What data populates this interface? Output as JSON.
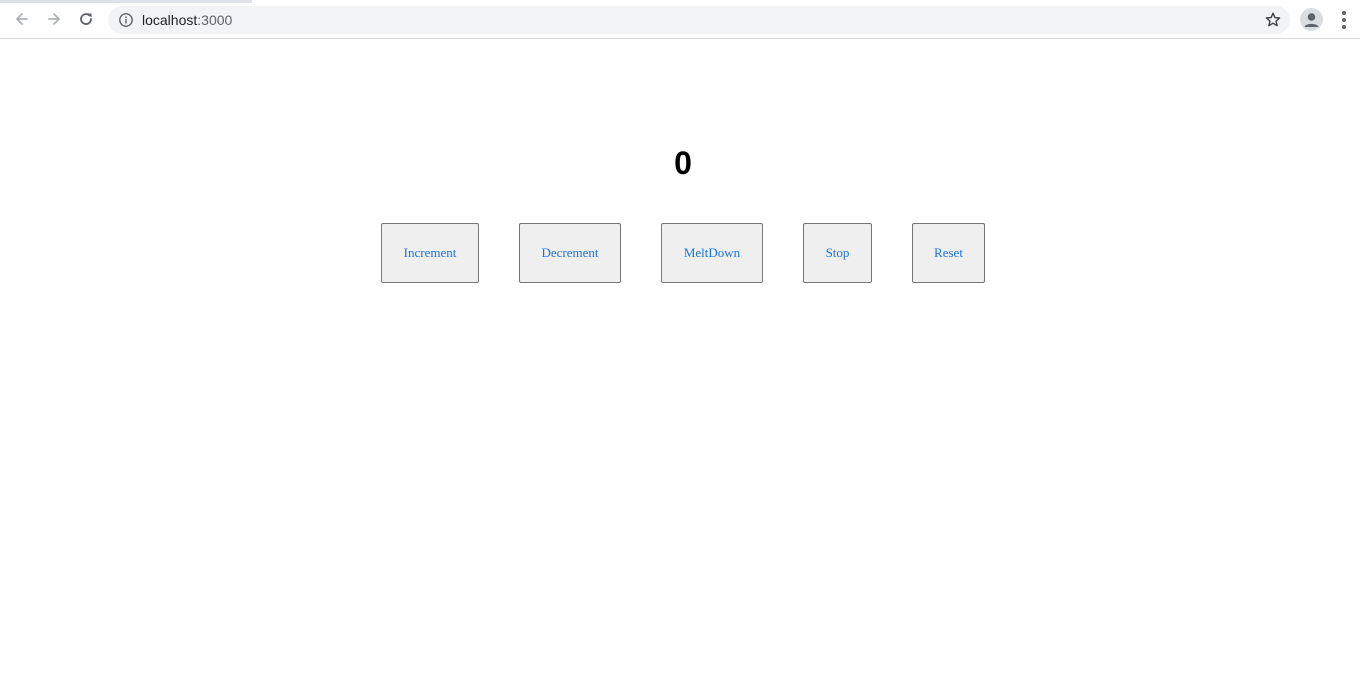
{
  "browser": {
    "url_host": "localhost",
    "url_port": ":3000",
    "icons": {
      "back": "arrow-left-icon",
      "forward": "arrow-right-icon",
      "reload": "reload-icon",
      "site_info": "info-icon",
      "bookmark": "star-icon",
      "profile": "account-icon",
      "menu": "kebab-menu-icon"
    }
  },
  "counter": {
    "value": "0"
  },
  "buttons": {
    "increment": "Increment",
    "decrement": "Decrement",
    "meltdown": "MeltDown",
    "stop": "Stop",
    "reset": "Reset"
  },
  "colors": {
    "button_text": "#1a73e8",
    "button_bg": "#efefef",
    "button_border": "#767676",
    "chrome_toolbar": "#ffffff",
    "omnibox_bg": "#f1f3f4"
  }
}
